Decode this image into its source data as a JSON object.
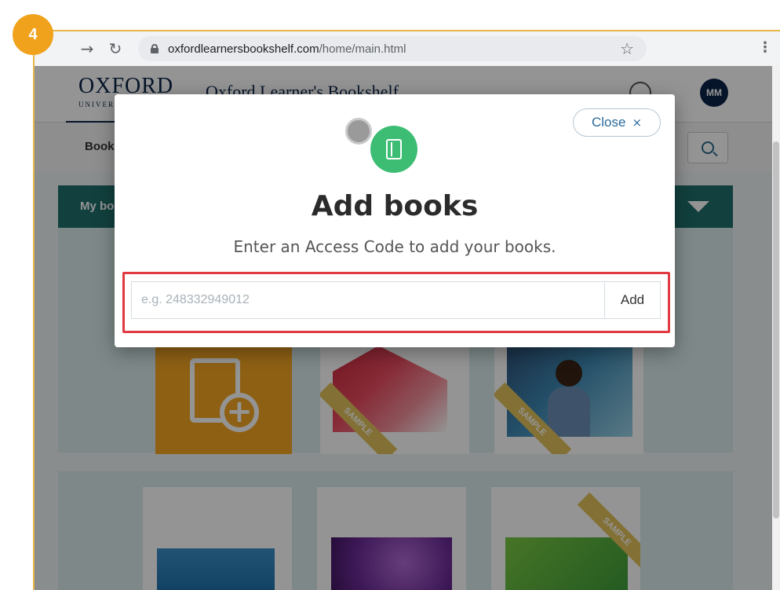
{
  "step": {
    "number": "4"
  },
  "browser": {
    "url_host": "oxfordlearnersbookshelf.com",
    "url_path": "/home/main.html"
  },
  "site": {
    "logo": "OXFORD",
    "logo_sub": "UNIVERSITY PRESS",
    "title": "Oxford Learner's Bookshelf",
    "avatar_initials": "MM",
    "subnav_label": "Books",
    "shelf_label": "My books"
  },
  "books": {
    "sample_label": "SAMPLE"
  },
  "modal": {
    "close_label": "Close",
    "close_icon": "×",
    "title": "Add books",
    "subtitle": "Enter an Access Code to add your books.",
    "input_placeholder": "e.g. 248332949012",
    "input_value": "",
    "add_label": "Add"
  },
  "colors": {
    "accent_green": "#3dbd74",
    "teal_bar": "#1e6f6b",
    "highlight_red": "#e03a42",
    "step_badge": "#f0a21c"
  },
  "icons": [
    "back-icon",
    "forward-icon",
    "reload-icon",
    "lock-icon",
    "star-icon",
    "menu-icon",
    "globe-icon",
    "search-icon",
    "notebook-icon",
    "close-icon",
    "add-book-icon"
  ]
}
